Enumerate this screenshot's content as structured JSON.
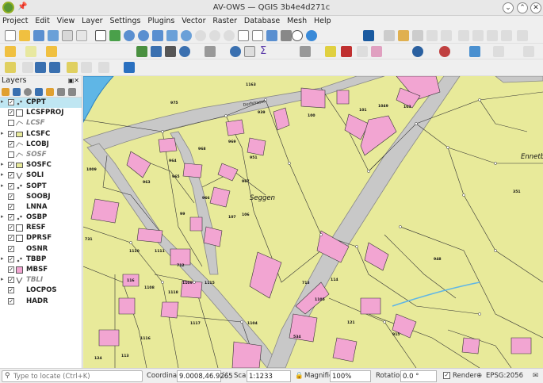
{
  "window": {
    "title": "AV-OWS — QGIS 3b4e4d271c"
  },
  "menu": [
    "Project",
    "Edit",
    "View",
    "Layer",
    "Settings",
    "Plugins",
    "Vector",
    "Raster",
    "Database",
    "Mesh",
    "Help"
  ],
  "panel": {
    "title": "Layers"
  },
  "layers": [
    {
      "name": "CPPT",
      "checked": true,
      "selected": true,
      "expand": true,
      "kind": "point"
    },
    {
      "name": "LCSFPROJ",
      "checked": true,
      "kind": "polygon-empty"
    },
    {
      "name": "LCSF",
      "checked": false,
      "off": true,
      "kind": "line"
    },
    {
      "name": "LCSFC",
      "checked": true,
      "expand": true,
      "kind": "polygon"
    },
    {
      "name": "LCOBJ",
      "checked": true,
      "kind": "line"
    },
    {
      "name": "SOSF",
      "checked": false,
      "off": true,
      "kind": "line"
    },
    {
      "name": "SOSFC",
      "checked": true,
      "expand": true,
      "kind": "polygon"
    },
    {
      "name": "SOLI",
      "checked": true,
      "expand": true,
      "kind": "line-v"
    },
    {
      "name": "SOPT",
      "checked": true,
      "expand": true,
      "kind": "point"
    },
    {
      "name": "SOOBJ",
      "checked": true,
      "kind": "none"
    },
    {
      "name": "LNNA",
      "checked": true,
      "kind": "none"
    },
    {
      "name": "OSBP",
      "checked": true,
      "expand": true,
      "kind": "point"
    },
    {
      "name": "RESF",
      "checked": true,
      "kind": "polygon-empty"
    },
    {
      "name": "DPRSF",
      "checked": true,
      "kind": "polygon-empty"
    },
    {
      "name": "OSNR",
      "checked": true,
      "kind": "none"
    },
    {
      "name": "TBBP",
      "checked": true,
      "expand": true,
      "kind": "point"
    },
    {
      "name": "MBSF",
      "checked": true,
      "kind": "polygon-pink"
    },
    {
      "name": "TBLI",
      "checked": true,
      "off": true,
      "expand": true,
      "kind": "line-v"
    },
    {
      "name": "LOCPOS",
      "checked": true,
      "kind": "none"
    },
    {
      "name": "HADR",
      "checked": true,
      "kind": "none"
    }
  ],
  "map": {
    "place_labels": [
      "Seggen",
      "Ennetb"
    ],
    "street_label": "Dorfstrasse",
    "parcel_numbers": [
      "1163",
      "975",
      "939",
      "100",
      "101",
      "1049",
      "103",
      "968",
      "969",
      "951",
      "964",
      "965",
      "967",
      "963",
      "1009",
      "966",
      "99",
      "106",
      "107",
      "351",
      "731",
      "1110",
      "1111",
      "712",
      "713",
      "114",
      "948",
      "116",
      "1108",
      "1109",
      "1115",
      "1118",
      "1117",
      "1116",
      "1105",
      "121",
      "915",
      "534",
      "124",
      "1104",
      "113",
      "1103"
    ]
  },
  "status": {
    "locate_placeholder": "Type to locate (Ctrl+K)",
    "coordinate_label": "Coordinate",
    "coordinate_value": "9.0008,46.9265",
    "scale_label": "Scale",
    "scale_value": "1:1233",
    "magnifier_label": "Magnifier",
    "magnifier_value": "100%",
    "rotation_label": "Rotation",
    "rotation_value": "0.0 °",
    "render_label": "Render",
    "crs_label": "EPSG:2056"
  },
  "colors": {
    "map_bg": "#e8ea9a",
    "building": "#f2a5d2",
    "road": "#c8c8c8",
    "water": "#5fb6e6",
    "selection": "#bfe6f2"
  }
}
